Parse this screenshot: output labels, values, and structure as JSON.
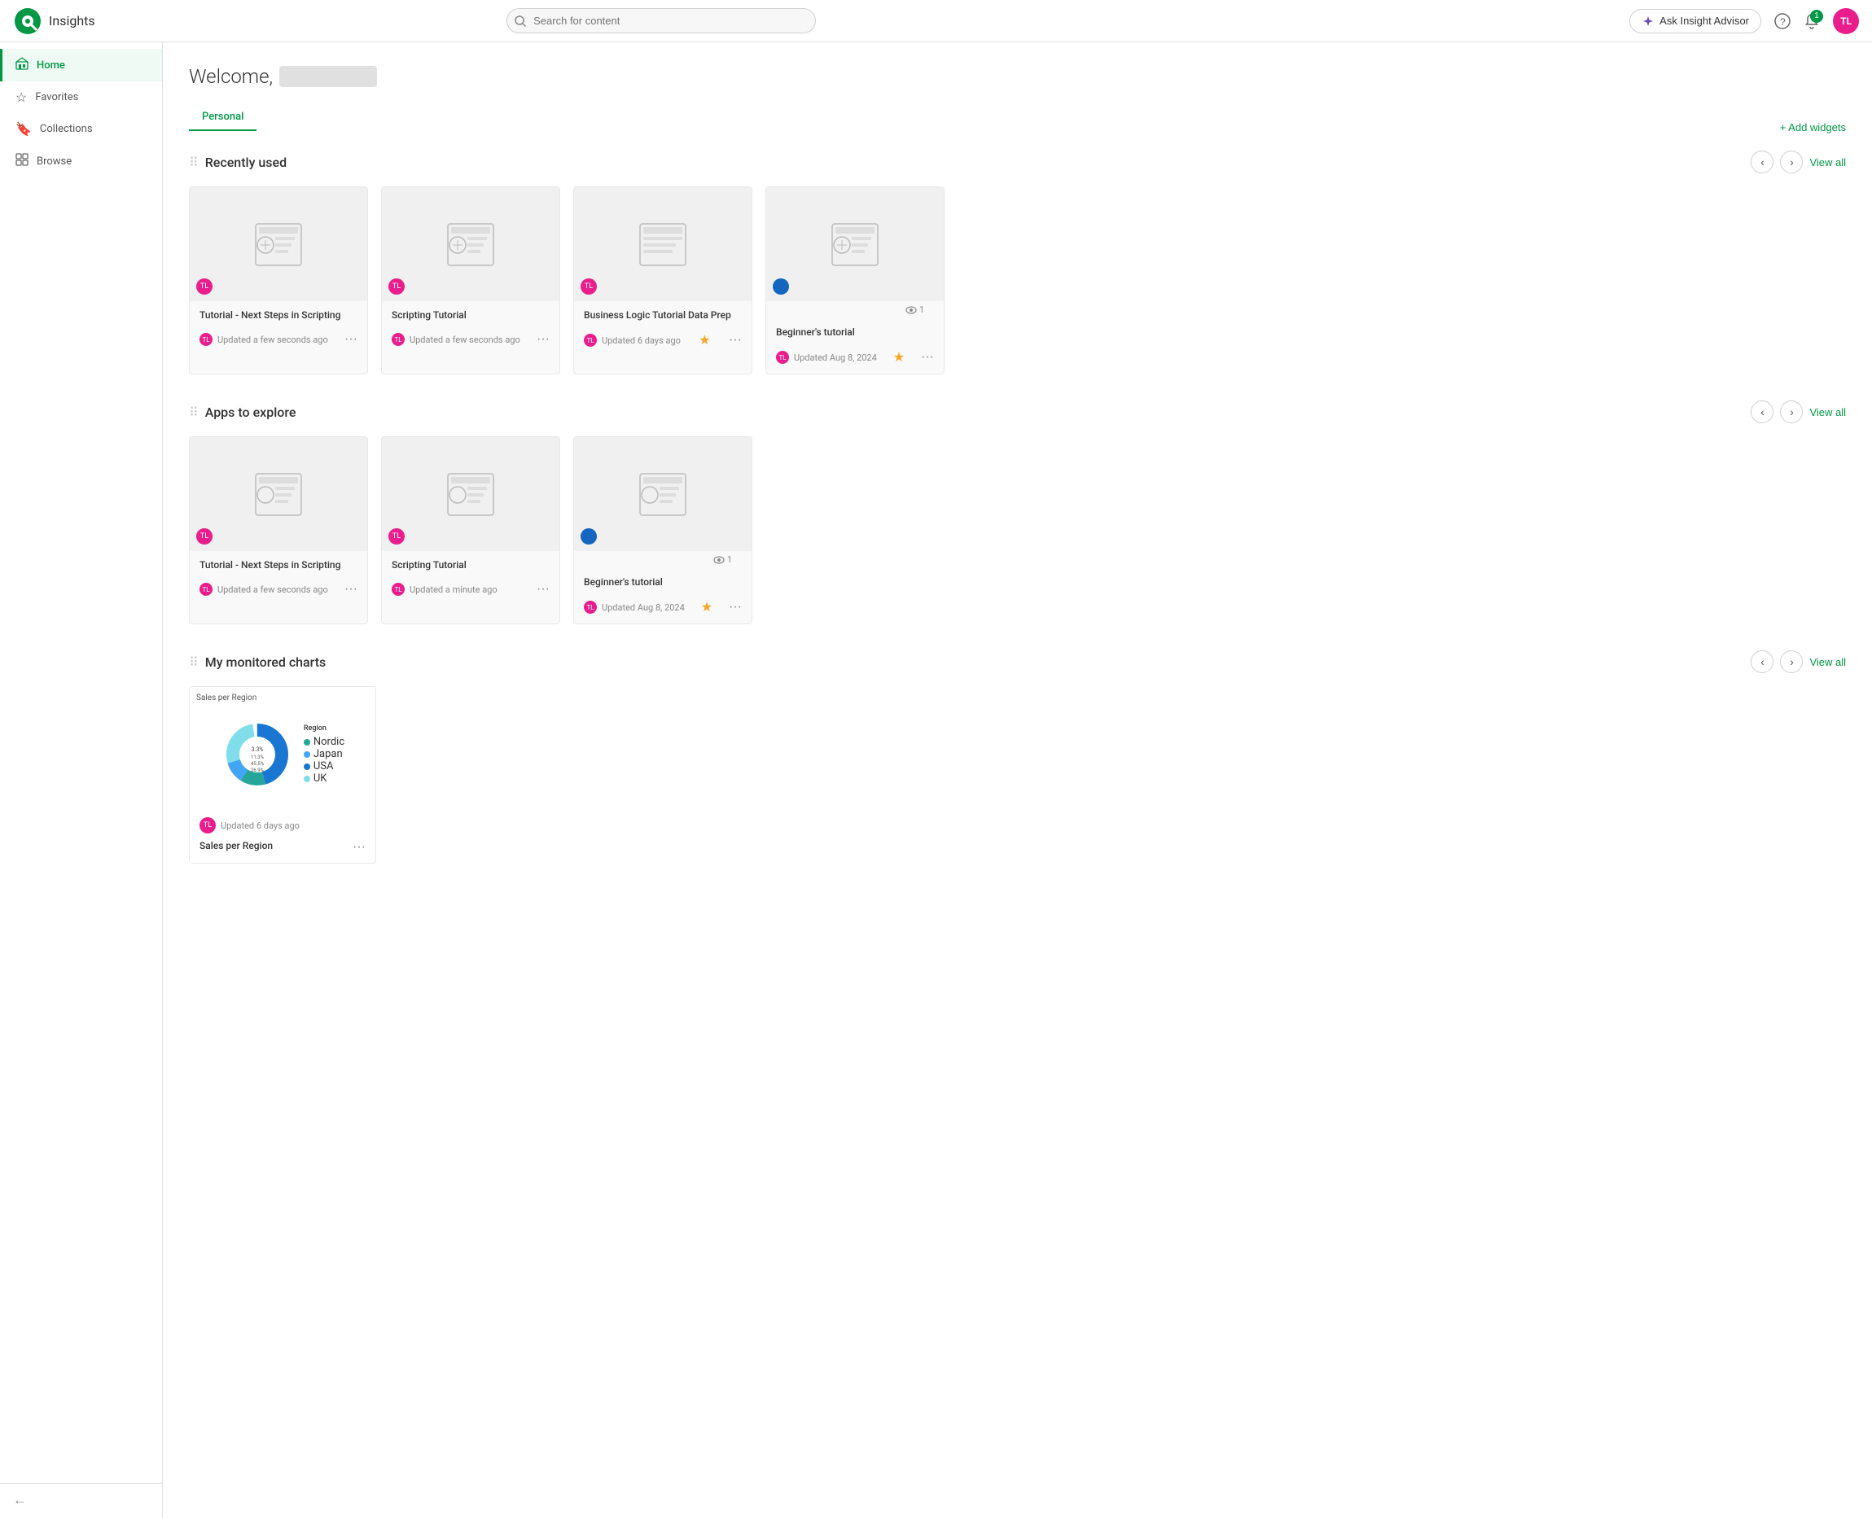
{
  "topbar": {
    "app_title": "Insights",
    "search_placeholder": "Search for content",
    "ask_insight_label": "Ask Insight Advisor",
    "help_label": "?",
    "notif_count": "1",
    "avatar_initials": "TL"
  },
  "sidebar": {
    "items": [
      {
        "id": "home",
        "label": "Home",
        "icon": "⊞",
        "active": true
      },
      {
        "id": "favorites",
        "label": "Favorites",
        "icon": "☆",
        "active": false
      },
      {
        "id": "collections",
        "label": "Collections",
        "icon": "🔖",
        "active": false
      },
      {
        "id": "browse",
        "label": "Browse",
        "icon": "⊡",
        "active": false
      }
    ],
    "collapse_label": "←"
  },
  "main": {
    "welcome_text": "Welcome,",
    "add_widgets_label": "+ Add widgets",
    "tabs": [
      {
        "id": "personal",
        "label": "Personal",
        "active": true
      }
    ],
    "recently_used": {
      "title": "Recently used",
      "view_all": "View all",
      "views_count": "1",
      "cards": [
        {
          "id": "card1",
          "title": "Tutorial - Next Steps in Scripting",
          "updated": "Updated a few seconds ago",
          "starred": false,
          "avatar_type": "pink"
        },
        {
          "id": "card2",
          "title": "Scripting Tutorial",
          "updated": "Updated a few seconds ago",
          "starred": false,
          "avatar_type": "pink"
        },
        {
          "id": "card3",
          "title": "Business Logic Tutorial Data Prep",
          "updated": "Updated 6 days ago",
          "starred": true,
          "avatar_type": "pink"
        },
        {
          "id": "card4",
          "title": "Beginner's tutorial",
          "updated": "Updated Aug 8, 2024",
          "starred": true,
          "avatar_type": "pink",
          "owner_badge": "blue"
        }
      ]
    },
    "apps_to_explore": {
      "title": "Apps to explore",
      "view_all": "View all",
      "views_count": "1",
      "cards": [
        {
          "id": "acard1",
          "title": "Tutorial - Next Steps in Scripting",
          "updated": "Updated a few seconds ago",
          "starred": false,
          "avatar_type": "pink"
        },
        {
          "id": "acard2",
          "title": "Scripting Tutorial",
          "updated": "Updated a minute ago",
          "starred": false,
          "avatar_type": "pink"
        },
        {
          "id": "acard3",
          "title": "Beginner's tutorial",
          "updated": "Updated Aug 8, 2024",
          "starred": true,
          "avatar_type": "pink",
          "owner_badge": "blue"
        }
      ]
    },
    "monitored_charts": {
      "title": "My monitored charts",
      "view_all": "View all",
      "chart": {
        "title": "Sales per Region",
        "updated": "Updated 6 days ago",
        "legend_title": "Region",
        "segments": [
          {
            "label": "USA",
            "value": 45.5,
            "color": "#1976d2"
          },
          {
            "label": "Nordic",
            "value": 13.3,
            "color": "#26a69a"
          },
          {
            "label": "Japan",
            "value": 11.3,
            "color": "#42a5f5"
          },
          {
            "label": "UK",
            "value": 26.9,
            "color": "#80deea"
          }
        ]
      }
    }
  }
}
